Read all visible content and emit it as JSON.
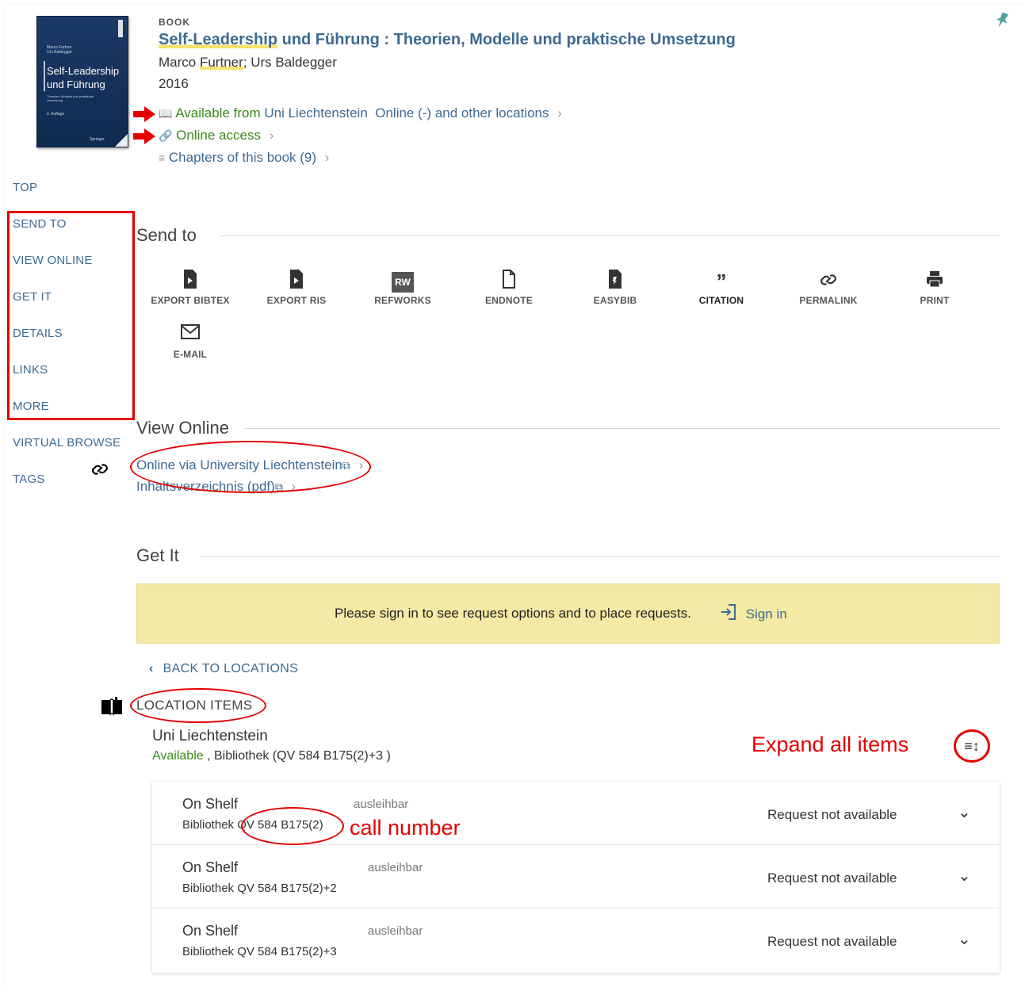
{
  "record": {
    "type": "BOOK",
    "title_part1": "Self-Leadership",
    "title_part2": " und Führung : Theorien, Modelle und praktische Umsetzung",
    "author1": "Marco ",
    "author1_last": "Furtner",
    "author_sep": "; Urs Baldegger",
    "year": "2016",
    "availability_prefix": "Available from ",
    "availability_library": "Uni Liechtenstein",
    "availability_location": "Online (-)",
    "availability_suffix": " and other locations",
    "online_access": "Online access",
    "chapters": "Chapters of this book (9)"
  },
  "cover": {
    "authors": "Marco Furtner Urs Baldegger",
    "title_line1": "Self-Leadership",
    "title_line2": "und Führung",
    "subtitle": "Theorien, Modelle und praktische Umsetzung",
    "edition": "2. Auflage",
    "publisher": "Springer"
  },
  "nav": {
    "top": "TOP",
    "send_to": "SEND TO",
    "view_online": "VIEW ONLINE",
    "get_it": "GET IT",
    "details": "DETAILS",
    "links": "LINKS",
    "more": "MORE",
    "virtual_browse": "VIRTUAL BROWSE",
    "tags": "TAGS"
  },
  "send_to": {
    "title": "Send to",
    "items": [
      {
        "label": "EXPORT BIBTEX",
        "icon": "file-export-icon"
      },
      {
        "label": "EXPORT RIS",
        "icon": "file-export-icon"
      },
      {
        "label": "REFWORKS",
        "icon": "refworks-icon",
        "glyph": "RW"
      },
      {
        "label": "ENDNOTE",
        "icon": "document-icon"
      },
      {
        "label": "EASYBIB",
        "icon": "easybib-icon"
      },
      {
        "label": "CITATION",
        "icon": "quote-icon"
      },
      {
        "label": "PERMALINK",
        "icon": "link-icon"
      },
      {
        "label": "PRINT",
        "icon": "print-icon"
      },
      {
        "label": "E-MAIL",
        "icon": "mail-icon"
      }
    ]
  },
  "view_online": {
    "title": "View Online",
    "link1": "Online via University Liechtenstein",
    "link2": "Inhaltsverzeichnis (pdf)"
  },
  "get_it": {
    "title": "Get It",
    "signin_message": "Please sign in to see request options and to place requests.",
    "signin_link": "Sign in",
    "back_link": "BACK TO LOCATIONS",
    "location_items": "LOCATION ITEMS",
    "library": "Uni Liechtenstein",
    "status_available": "Available",
    "status_rest": " , Bibliothek (QV 584 B175(2)+3 )",
    "items": [
      {
        "status": "On Shelf",
        "policy": "ausleihbar",
        "location": "Bibliothek ",
        "call_number": "QV 584 B175(2)",
        "request": "Request not available"
      },
      {
        "status": "On Shelf",
        "policy": "ausleihbar",
        "location": "Bibliothek ",
        "call_number": "QV 584 B175(2)+2",
        "request": "Request not available"
      },
      {
        "status": "On Shelf",
        "policy": "ausleihbar",
        "location": "Bibliothek ",
        "call_number": "QV 584 B175(2)+3",
        "request": "Request not available"
      }
    ]
  },
  "annotations": {
    "expand_all": "Expand all items",
    "call_number": "call number"
  },
  "colors": {
    "link_blue": "#3d6a93",
    "available_green": "#3b8a17",
    "annotation_red": "#e50000",
    "signin_bar": "#f4eaa5"
  }
}
